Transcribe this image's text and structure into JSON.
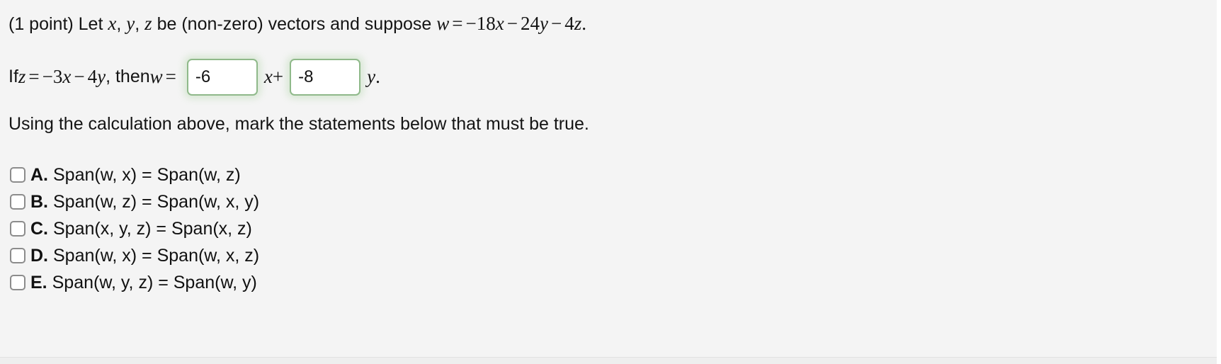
{
  "problem": {
    "points_label": "(1 point)",
    "line1": {
      "prefix": "(1 point) Let ",
      "var_x": "x",
      "comma1": ", ",
      "var_y": "y",
      "comma2": ", ",
      "var_z": "z",
      "middle": " be (non-zero) vectors and suppose ",
      "eq_w": "w",
      "eq_sign": "=",
      "term1_coef": "−18",
      "term1_var": "x",
      "op1": "−",
      "term2_coef": "24",
      "term2_var": "y",
      "op2": "−",
      "term3_coef": "4",
      "term3_var": "z",
      "period": "."
    },
    "line2": {
      "if_word": "If ",
      "var_z": "z",
      "eq_sign": "=",
      "coef1": "−3",
      "var_x": "x",
      "op": "−",
      "coef2": "4",
      "var_y": "y",
      "then_word": ", then ",
      "var_w": "w",
      "eq_sign2": "=",
      "after_first_input": "x",
      "plus": "+",
      "after_second_input": "y",
      "period": "."
    },
    "instruction": "Using the calculation above, mark the statements below that must be true."
  },
  "inputs": {
    "coefficient_x": {
      "value": "-6",
      "placeholder": ""
    },
    "coefficient_y": {
      "value": "-8",
      "placeholder": ""
    }
  },
  "options": [
    {
      "letter": "A.",
      "text": "Span(w, x) = Span(w, z)",
      "checked": false
    },
    {
      "letter": "B.",
      "text": "Span(w, z) = Span(w, x, y)",
      "checked": false
    },
    {
      "letter": "C.",
      "text": "Span(x, y, z) = Span(x, z)",
      "checked": false
    },
    {
      "letter": "D.",
      "text": "Span(w, x) = Span(w, x, z)",
      "checked": false
    },
    {
      "letter": "E.",
      "text": "Span(w, y, z) = Span(w, y)",
      "checked": false
    }
  ],
  "colors": {
    "page_background": "#f4f4f4",
    "text": "#111111",
    "input_border_green": "#8fb98a",
    "input_glow_green": "#8cc57d",
    "checkbox_border": "#8c8c8c",
    "divider": "#e2e2e2"
  }
}
